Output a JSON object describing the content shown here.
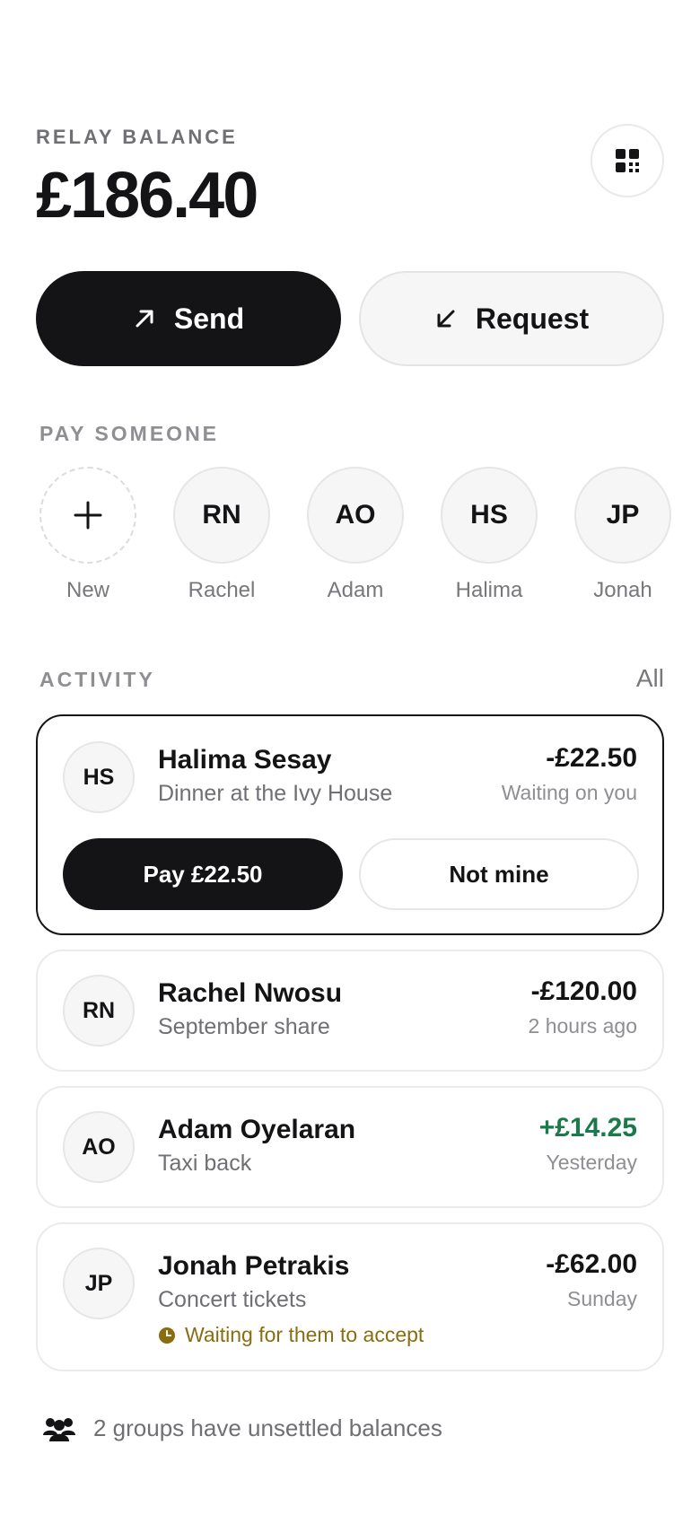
{
  "balance": {
    "label": "RELAY BALANCE",
    "amount": "£186.40"
  },
  "header": {
    "qr_icon": "qr-code-icon"
  },
  "actions": {
    "send_label": "Send",
    "send_icon": "arrow-up-right-icon",
    "request_label": "Request",
    "request_icon": "arrow-down-left-icon"
  },
  "pay_someone": {
    "label": "PAY SOMEONE",
    "contacts": [
      {
        "initials": "+",
        "name": "New"
      },
      {
        "initials": "RN",
        "name": "Rachel"
      },
      {
        "initials": "AO",
        "name": "Adam"
      },
      {
        "initials": "HS",
        "name": "Halima"
      },
      {
        "initials": "JP",
        "name": "Jonah"
      }
    ]
  },
  "activity": {
    "label": "ACTIVITY",
    "all_label": "All",
    "items": [
      {
        "initials": "HS",
        "name": "Halima Sesay",
        "desc": "Dinner at the Ivy House",
        "amount": "-£22.50",
        "meta": "Waiting on you",
        "pay_label": "Pay £22.50",
        "decline_label": "Not mine"
      },
      {
        "initials": "RN",
        "name": "Rachel Nwosu",
        "desc": "September share",
        "amount": "-£120.00",
        "meta": "2 hours ago"
      },
      {
        "initials": "AO",
        "name": "Adam Oyelaran",
        "desc": "Taxi back",
        "amount": "+£14.25",
        "meta": "Yesterday"
      },
      {
        "initials": "JP",
        "name": "Jonah Petrakis",
        "desc": "Concert tickets",
        "amount": "-£62.00",
        "meta": "Sunday",
        "status": "Waiting for them to accept"
      }
    ]
  },
  "groups": {
    "text": "2 groups have unsettled balances",
    "icon": "group-icon"
  },
  "colors": {
    "primary": "#141416",
    "positive": "#1b7a4a",
    "pending": "#8a6d10",
    "muted": "#8e8e93"
  }
}
